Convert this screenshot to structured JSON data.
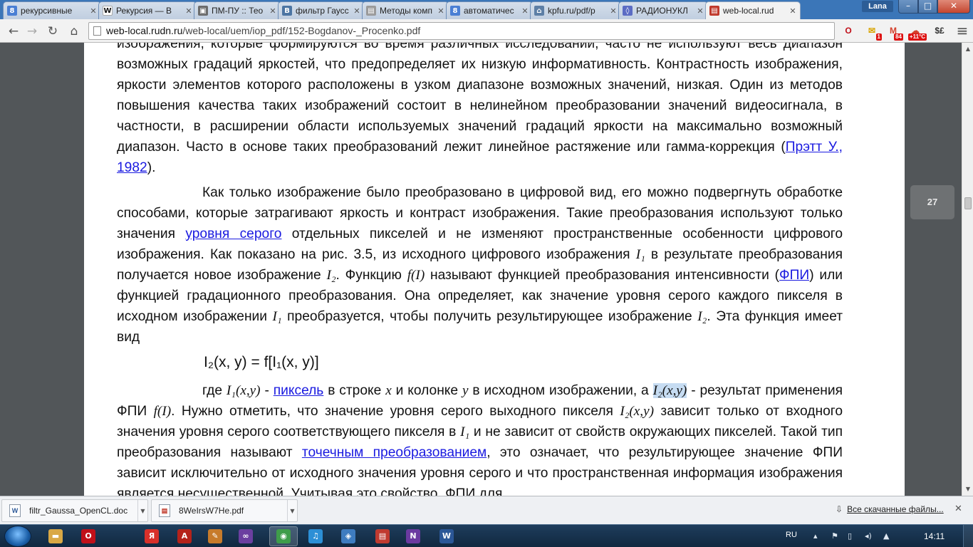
{
  "window": {
    "user_name": "Lana",
    "minimize_glyph": "–",
    "maximize_glyph": "□",
    "close_glyph": "✕"
  },
  "tabs": [
    {
      "title": "рекурсивные",
      "icon": "google-icon",
      "color": "#4a7fd4",
      "glyph": "8"
    },
    {
      "title": "Рекурсия — В",
      "icon": "wikipedia-icon",
      "color": "#ffffff",
      "glyph": "W"
    },
    {
      "title": "ПМ-ПУ :: Тео",
      "icon": "page-icon",
      "color": "#6b6b6b",
      "glyph": "▣"
    },
    {
      "title": "фильтр Гаусс",
      "icon": "vk-icon",
      "color": "#4c75a3",
      "glyph": "B"
    },
    {
      "title": "Методы комп",
      "icon": "document-icon",
      "color": "#9a9a9a",
      "glyph": "▤"
    },
    {
      "title": "автоматичес",
      "icon": "google-icon",
      "color": "#4a7fd4",
      "glyph": "8"
    },
    {
      "title": "kpfu.ru/pdf/p",
      "icon": "building-icon",
      "color": "#5d7fa6",
      "glyph": "⌂"
    },
    {
      "title": "РАДИОНУКЛ",
      "icon": "radiation-icon",
      "color": "#5b6cc4",
      "glyph": "◊"
    },
    {
      "title": "web-local.rud",
      "icon": "pdf-icon",
      "color": "#c0392b",
      "glyph": "▤"
    }
  ],
  "toolbar": {
    "back_glyph": "←",
    "forward_glyph": "→",
    "reload_glyph": "↻",
    "home_glyph": "⌂",
    "url_host": "web-local.rudn.ru",
    "url_path": "/web-local/uem/iop_pdf/152-Bogdanov-_Procenko.pdf",
    "zoom_glyph": "⊕",
    "star_glyph": "☆",
    "menu_glyph": "≡",
    "extensions": [
      {
        "name": "opera-icon",
        "glyph": "O",
        "color": "#c0101a",
        "badge": ""
      },
      {
        "name": "mail-notifier-icon",
        "glyph": "✉",
        "color": "#d8a400",
        "badge": "1"
      },
      {
        "name": "gmail-icon",
        "glyph": "M",
        "color": "#d4402c",
        "badge": "84"
      },
      {
        "name": "weather-icon",
        "glyph": "☁",
        "color": "#d4402c",
        "badge": "+11°C"
      },
      {
        "name": "currency-icon",
        "glyph": "$£",
        "color": "#333333",
        "badge": ""
      }
    ]
  },
  "document": {
    "page_number": "27",
    "para1_top": "изображения, которые формируются во время различных исследований, часто не используют весь диапазон возможных градаций яркостей, что предопределяет их низкую информативность. Контрастность изображения, яркости элементов которого расположены в узком диапазоне возможных значений, низкая. Один из методов повышения качества таких изображений состоит в нелинейном преобразовании значений видеосигнала, в частности, в расширении области используемых значений градаций яркости на максимально возможный диапазон. Часто в основе таких преобразований лежит линейное растяжение или гамма-коррекция (",
    "link_pratt": "Прэтт У., 1982",
    "para1_end": ").",
    "p2_a": "Как только изображение было преобразовано в цифровой вид, его можно подвергнуть обработке способами, которые затрагивают яркость и контраст изображения. Такие преобразования используют только значения ",
    "link_gray_level": "уровня серого",
    "p2_b": " отдельных пикселей и не изменяют пространственные особенности цифрового изображения. Как показано на рис. 3.5, из исходного цифрового изображения ",
    "i1": "I₁",
    "p2_c": " в результате преобразования получается новое изображение ",
    "i2": "I₂",
    "p2_d": ". Функцию ",
    "fI": "f(I)",
    "p2_e": " называют функцией преобразования интенсивности (",
    "link_fpi": "ФПИ",
    "p2_f": ") или функцией градационного преобразования. Она определяет, как значение уровня серого каждого пикселя в исходном изображении ",
    "p2_g": " преобразуется, чтобы получить результирующее изображение ",
    "p2_h": ". Эта функция имеет вид",
    "formula": "I₂(x, y) = f[I₁(x, y)]",
    "p3_a": "где ",
    "i1xy": "I₁(x,y)",
    "p3_b": " - ",
    "link_pixel": "пиксель",
    "p3_c": " в строке ",
    "x": "x",
    "p3_d": " и колонке ",
    "y": "y",
    "p3_e": " в исходном изображении, а ",
    "i2xy": "I₂(x,y)",
    "p3_f": " - результат применения ФПИ ",
    "p3_g": ". Нужно отметить, что значение уровня серого выходного пикселя ",
    "p3_h": " зависит только от входного значения уровня серого соответствующего пикселя в ",
    "p3_i": " и не зависит от свойств окружающих пикселей. Такой тип преобразования называют ",
    "link_point": "точечным преобразованием",
    "p3_j": ", это означает, что результирующее значение ФПИ зависит исключительно от исходного значения уровня серого и что пространственная информация изображения является несущественной. Учитывая это свойство, ФПИ для"
  },
  "downloads": {
    "items": [
      {
        "name": "filtr_Gaussa_OpenCL.doc",
        "icon": "word-doc-icon",
        "glyph": "W",
        "color": "#2b5797"
      },
      {
        "name": "8WeIrsW7He.pdf",
        "icon": "pdf-file-icon",
        "glyph": "▤",
        "color": "#c0392b"
      }
    ],
    "show_all": "Все скачанные файлы...",
    "show_all_glyph": "⇩",
    "close_glyph": "✕"
  },
  "taskbar": {
    "apps": [
      {
        "name": "explorer-icon",
        "glyph": "▬",
        "color": "#d9a845"
      },
      {
        "name": "opera-icon",
        "glyph": "O",
        "color": "#c0101a"
      },
      {
        "name": "yandex-browser-icon",
        "glyph": "Я",
        "color": "#d8302a"
      },
      {
        "name": "acrobat-icon",
        "glyph": "A",
        "color": "#b5221a"
      },
      {
        "name": "paint-icon",
        "glyph": "✎",
        "color": "#c77b2b"
      },
      {
        "name": "visual-studio-icon",
        "glyph": "∞",
        "color": "#6b3fa0"
      },
      {
        "name": "chrome-icon",
        "glyph": "◉",
        "color": "#3f9d4a"
      },
      {
        "name": "itunes-icon",
        "glyph": "♫",
        "color": "#2c8fd6"
      },
      {
        "name": "network-tool-icon",
        "glyph": "◈",
        "color": "#3e7cc0"
      },
      {
        "name": "pdf-viewer-icon",
        "glyph": "▤",
        "color": "#c03a30"
      },
      {
        "name": "onenote-icon",
        "glyph": "N",
        "color": "#6b3aa0"
      },
      {
        "name": "word-icon",
        "glyph": "W",
        "color": "#2b5797"
      }
    ],
    "language": "RU",
    "time": "14:11",
    "tray_icons": [
      "▴",
      "⚑",
      "▯",
      "◂)",
      "▲"
    ]
  }
}
